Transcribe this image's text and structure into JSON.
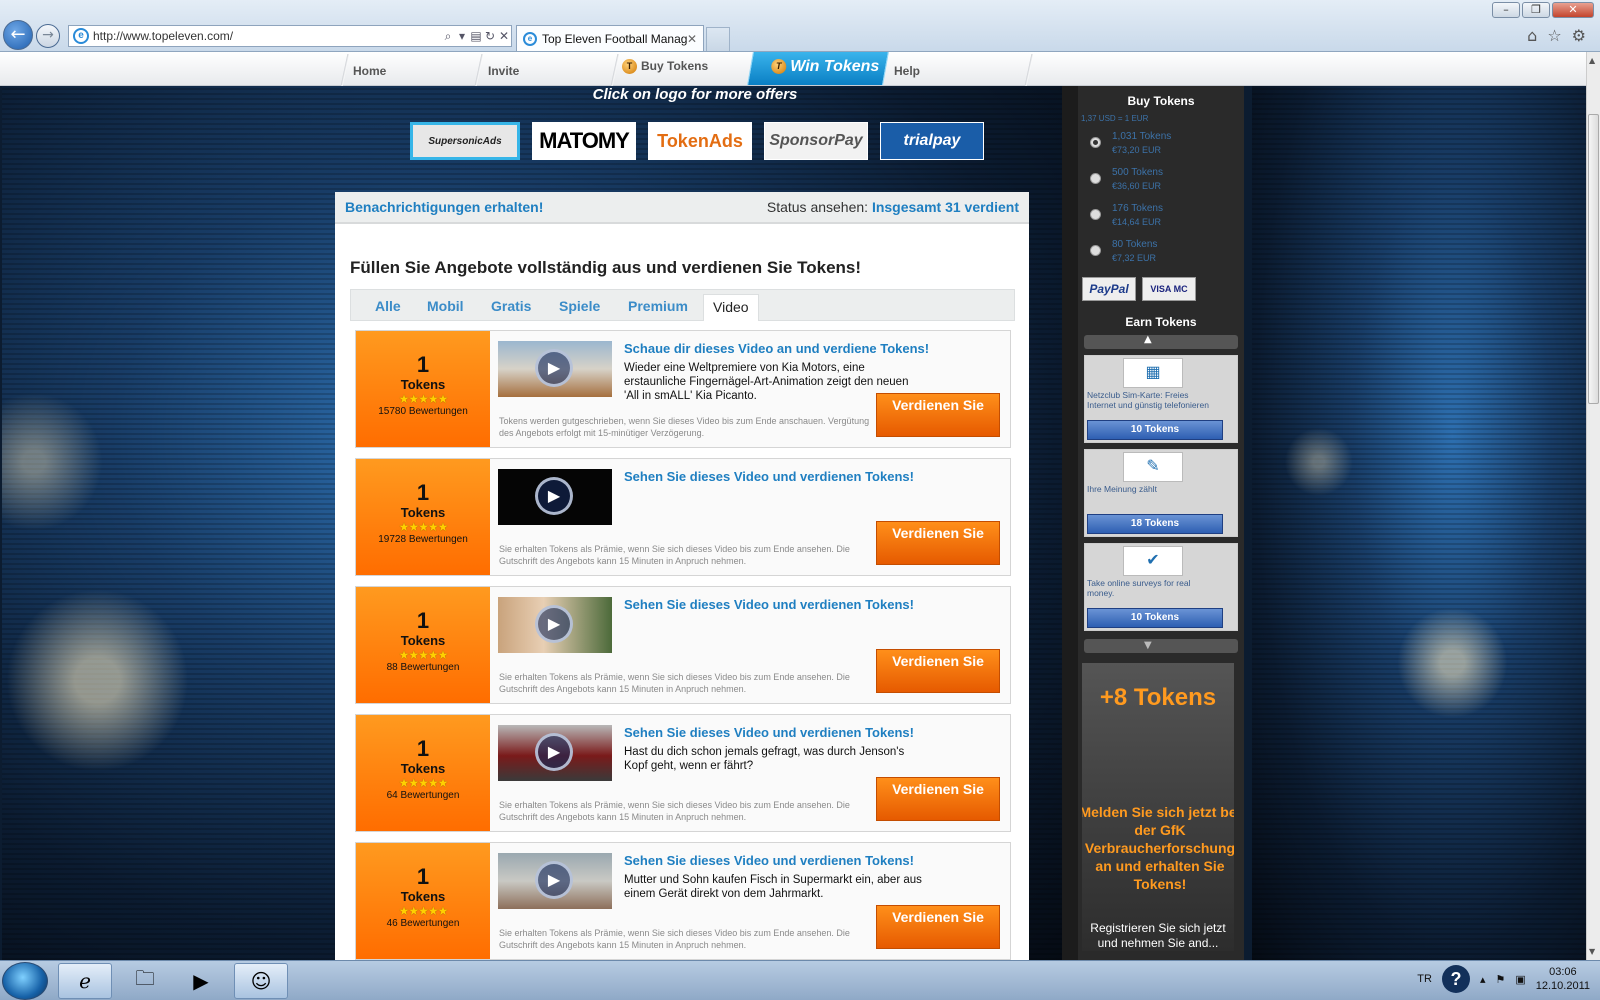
{
  "browser": {
    "url": "http://www.topeleven.com/",
    "tab_title": "Top Eleven Football Manag...",
    "win_controls": [
      "–",
      "❐",
      "✕"
    ]
  },
  "site_nav": {
    "home": "Home",
    "invite": "Invite",
    "buy_tokens": "Buy Tokens",
    "win_tokens": "Win Tokens",
    "help": "Help"
  },
  "offerwall": {
    "click_msg": "Click on logo for more offers",
    "logos": [
      "SupersonicAds",
      "MATOMY",
      "TokenAds",
      "SponsorPay",
      "trialpay"
    ],
    "notify": "Benachrichtigungen erhalten!",
    "status_label": "Status ansehen:",
    "status_value": "Insgesamt 31 verdient",
    "title": "Füllen Sie Angebote vollständig aus und verdienen Sie Tokens!",
    "tabs": [
      "Alle",
      "Mobil",
      "Gratis",
      "Spiele",
      "Premium",
      "Video"
    ],
    "active_tab": "Video",
    "offers": [
      {
        "amount": "1",
        "unit": "Tokens",
        "stars": "★★★★★",
        "ratings": "15780 Bewertungen",
        "title": "Schaue dir dieses Video an und verdiene Tokens!",
        "desc": "Wieder eine Weltpremiere von Kia Motors, eine erstaunliche Fingernägel-Art-Animation zeigt den neuen 'All in smALL' Kia Picanto.",
        "fine": "Tokens werden gutgeschrieben, wenn Sie dieses Video bis zum Ende anschauen. Vergütung des Angebots erfolgt mit 15-minütiger Verzögerung.",
        "button": "Verdienen Sie"
      },
      {
        "amount": "1",
        "unit": "Tokens",
        "stars": "★★★★★",
        "ratings": "19728 Bewertungen",
        "title": "Sehen Sie dieses Video und verdienen Tokens!",
        "desc": "",
        "fine": "Sie erhalten Tokens als Prämie, wenn Sie sich dieses Video bis zum Ende ansehen. Die Gutschrift des Angebots kann 15 Minuten in Anpruch nehmen.",
        "button": "Verdienen Sie"
      },
      {
        "amount": "1",
        "unit": "Tokens",
        "stars": "★★★★★",
        "ratings": "88 Bewertungen",
        "title": "Sehen Sie dieses Video und verdienen Tokens!",
        "desc": "",
        "fine": "Sie erhalten Tokens als Prämie, wenn Sie sich dieses Video bis zum Ende ansehen. Die Gutschrift des Angebots kann 15 Minuten in Anpruch nehmen.",
        "button": "Verdienen Sie"
      },
      {
        "amount": "1",
        "unit": "Tokens",
        "stars": "★★★★★",
        "ratings": "64 Bewertungen",
        "title": "Sehen Sie dieses Video und verdienen Tokens!",
        "desc": "Hast du dich schon jemals gefragt, was durch Jenson's Kopf geht, wenn er fährt?",
        "fine": "Sie erhalten Tokens als Prämie, wenn Sie sich dieses Video bis zum Ende ansehen. Die Gutschrift des Angebots kann 15 Minuten in Anpruch nehmen.",
        "button": "Verdienen Sie"
      },
      {
        "amount": "1",
        "unit": "Tokens",
        "stars": "★★★★★",
        "ratings": "46 Bewertungen",
        "title": "Sehen Sie dieses Video und verdienen Tokens!",
        "desc": "Mutter und Sohn kaufen Fisch in Supermarkt ein, aber aus einem Gerät direkt von dem Jahrmarkt.",
        "fine": "Sie erhalten Tokens als Prämie, wenn Sie sich dieses Video bis zum Ende ansehen. Die Gutschrift des Angebots kann 15 Minuten in Anpruch nehmen.",
        "button": "Verdienen Sie"
      }
    ]
  },
  "sidebar": {
    "buy_title": "Buy Tokens",
    "rate_note": "1,37 USD = 1 EUR",
    "packages": [
      {
        "tokens": "1,031 Tokens",
        "price": "€73,20 EUR",
        "selected": true
      },
      {
        "tokens": "500 Tokens",
        "price": "€36,60 EUR",
        "selected": false
      },
      {
        "tokens": "176 Tokens",
        "price": "€14,64 EUR",
        "selected": false
      },
      {
        "tokens": "80 Tokens",
        "price": "€7,32 EUR",
        "selected": false
      }
    ],
    "paypal": "PayPal",
    "cards": "VISA MC",
    "earn_title": "Earn Tokens",
    "earn_items": [
      {
        "text": "Netzclub Sim-Karte: Freies Internet und günstig telefonieren",
        "button": "10 Tokens"
      },
      {
        "text": "Ihre Meinung zählt",
        "button": "18 Tokens"
      },
      {
        "text": "Take online surveys for real money.",
        "button": "10 Tokens"
      }
    ],
    "promo_amount": "+8 Tokens",
    "promo_msg": "Melden Sie sich jetzt bei der GfK Verbraucherforschung an und erhalten Sie Tokens!",
    "promo_sub": "Registrieren Sie sich jetzt und nehmen Sie and..."
  },
  "taskbar": {
    "lang": "TR",
    "time": "03:06",
    "date": "12.10.2011"
  }
}
